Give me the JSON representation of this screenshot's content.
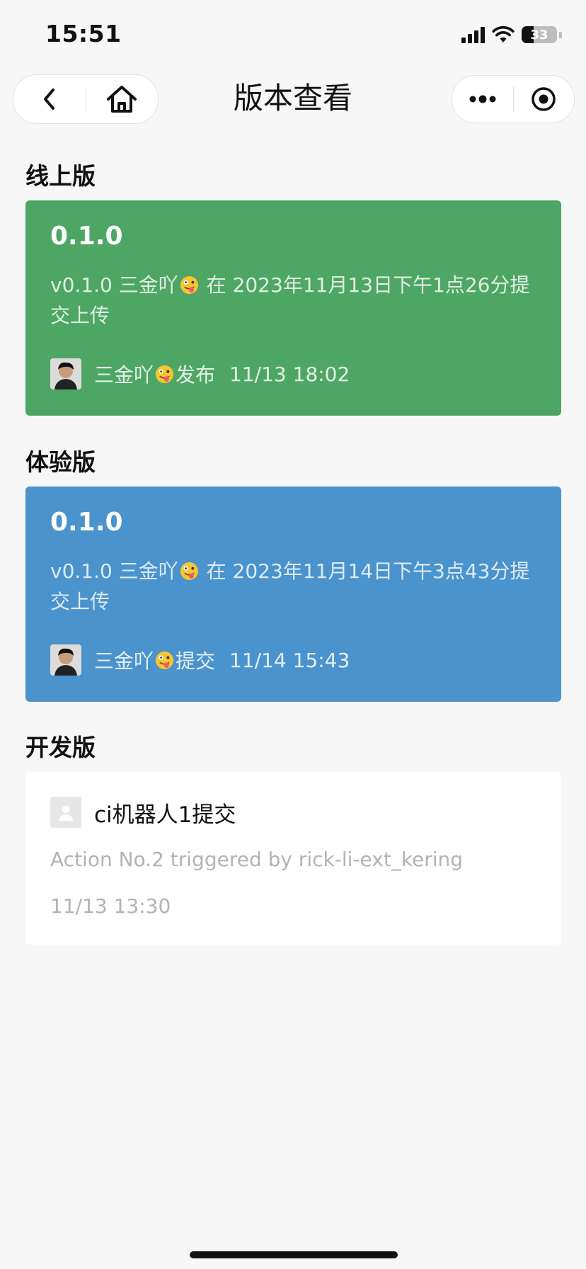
{
  "status_bar": {
    "time": "15:51",
    "battery": "33"
  },
  "nav": {
    "title": "版本查看"
  },
  "sections": {
    "online": {
      "title": "线上版",
      "version": "0.1.0",
      "desc_prefix": "v0.1.0 三金吖",
      "desc_suffix": " 在 2023年11月13日下午1点26分提交上传",
      "footer_user": "三金吖",
      "footer_action": "发布",
      "footer_time": "11/13 18:02"
    },
    "trial": {
      "title": "体验版",
      "version": "0.1.0",
      "desc_prefix": "v0.1.0 三金吖",
      "desc_suffix": " 在 2023年11月14日下午3点43分提交上传",
      "footer_user": "三金吖",
      "footer_action": "提交",
      "footer_time": "11/14 15:43"
    },
    "dev": {
      "title": "开发版",
      "name": "ci机器人1提交",
      "action": "Action No.2 triggered by rick-li-ext_kering",
      "time": "11/13 13:30"
    }
  },
  "colors": {
    "online_card": "#4ea664",
    "trial_card": "#4a93cc",
    "dev_card": "#ffffff",
    "background": "#f7f7f7"
  },
  "icons": [
    "back-icon",
    "home-icon",
    "more-icon",
    "close-target-icon",
    "wifi-icon",
    "signal-icon",
    "battery-icon",
    "tongue-emoji-icon",
    "user-placeholder-icon"
  ]
}
